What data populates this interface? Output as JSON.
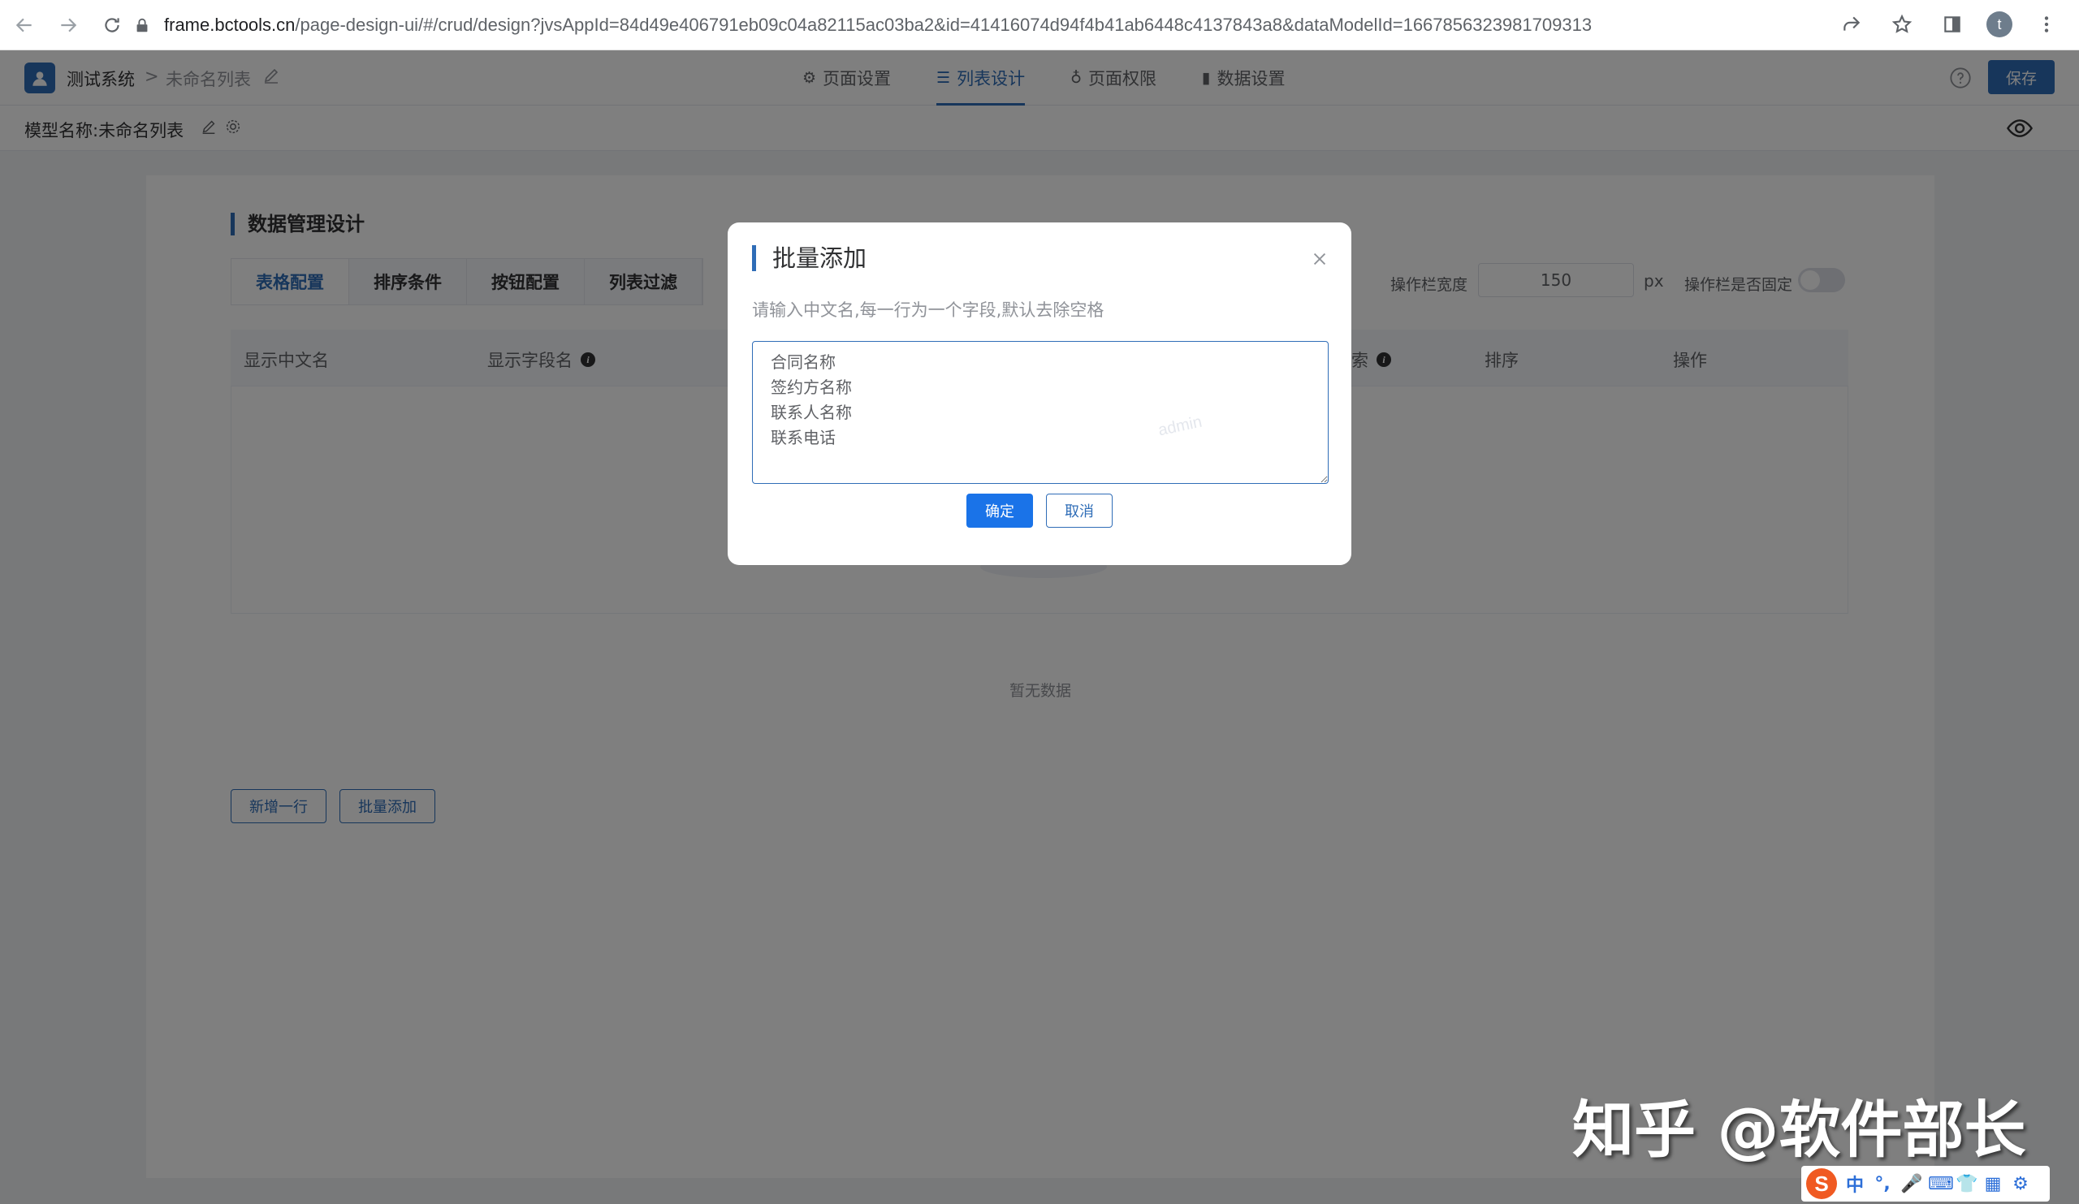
{
  "browser": {
    "url_host": "frame.bctools.cn",
    "url_path": "/page-design-ui/#/crud/design?jvsAppId=84d49e406791eb09c04a82115ac03ba2&id=41416074d94f4b41ab6448c4137843a8&dataModelId=1667856323981709313",
    "profile_initial": "t"
  },
  "header": {
    "system_name": "测试系统",
    "separator": ">",
    "list_name": "未命名列表",
    "tabs": [
      {
        "icon": "⚙",
        "label": "页面设置"
      },
      {
        "icon": "☰",
        "label": "列表设计"
      },
      {
        "icon": "♁",
        "label": "页面权限"
      },
      {
        "icon": "▮",
        "label": "数据设置"
      }
    ],
    "save_label": "保存"
  },
  "model": {
    "label": "模型名称:未命名列表"
  },
  "design": {
    "section_title": "数据管理设计",
    "sub_tabs": [
      "表格配置",
      "排序条件",
      "按钮配置",
      "列表过滤"
    ],
    "op_width_label": "操作栏宽度",
    "op_width_value": "150",
    "op_width_unit": "px",
    "op_fixed_label": "操作栏是否固定",
    "op_fixed_on": false,
    "columns": {
      "col1": "显示中文名",
      "col2": "显示字段名",
      "col3": "索",
      "col4": "排序",
      "col5": "操作"
    },
    "empty_text": "暂无数据",
    "add_row_label": "新增一行",
    "batch_add_label": "批量添加"
  },
  "dialog": {
    "title": "批量添加",
    "hint": "请输入中文名,每一行为一个字段,默认去除空格",
    "textarea_value": "合同名称\n签约方名称\n联系人名称\n联系电话",
    "watermark": "admin",
    "confirm_label": "确定",
    "cancel_label": "取消"
  },
  "overlay_watermark": "知乎 @软件部长",
  "ime": {
    "logo": "S",
    "items": [
      "中",
      "°,",
      "🎤",
      "⌨",
      "👕",
      "▦",
      "⚙"
    ]
  },
  "colors": {
    "primary": "#2f6db7",
    "confirm": "#1a73e8"
  }
}
